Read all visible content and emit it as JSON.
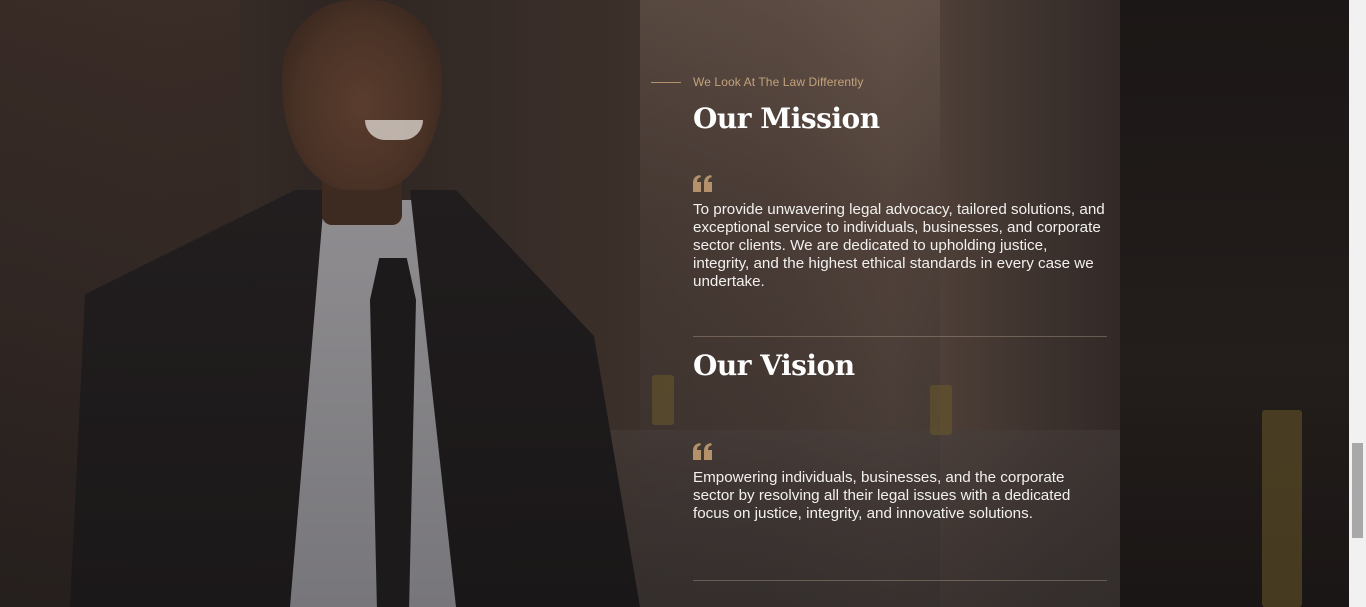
{
  "section": {
    "eyebrow": "We Look At The Law Differently",
    "mission": {
      "title": "Our Mission",
      "text": "To provide unwavering legal advocacy, tailored solutions, and exceptional service to individuals, businesses, and corporate sector clients. We are dedicated to upholding justice, integrity, and the highest ethical standards in every case we undertake."
    },
    "vision": {
      "title": "Our Vision",
      "text": "Empowering individuals, businesses, and the corporate sector by resolving all their legal issues with a dedicated focus on justice, integrity, and innovative solutions."
    }
  },
  "colors": {
    "accent": "#b3916a",
    "text": "#ffffff",
    "overlay": "#1a1614"
  },
  "icons": {
    "quote": "quote-icon"
  }
}
